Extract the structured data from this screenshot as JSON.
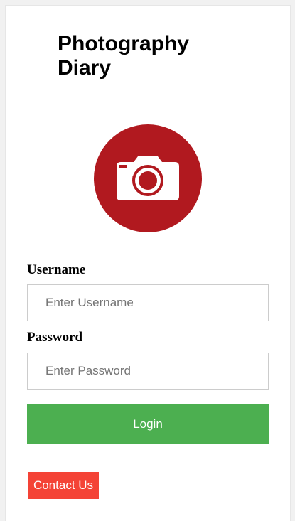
{
  "app": {
    "title": "Photography Diary",
    "logo_icon": "camera-icon",
    "brand_color": "#b1191f"
  },
  "form": {
    "username_label": "Username",
    "username_placeholder": "Enter Username",
    "username_value": "",
    "password_label": "Password",
    "password_placeholder": "Enter Password",
    "password_value": "",
    "login_label": "Login",
    "login_color": "#4caf50"
  },
  "footer": {
    "contact_label": "Contact Us",
    "contact_color": "#f44336"
  }
}
